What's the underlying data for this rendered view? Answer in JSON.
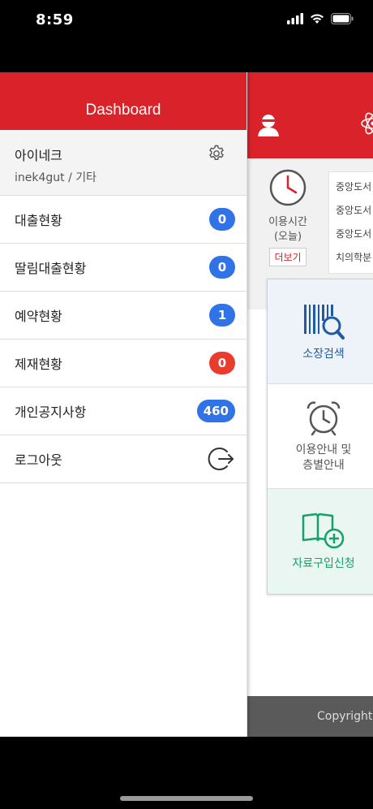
{
  "status": {
    "time": "8:59"
  },
  "drawer": {
    "title": "Dashboard",
    "profile": {
      "name": "아이네크",
      "subtitle": "inek4gut / 기타"
    },
    "items": [
      {
        "label": "대출현황",
        "badge": "0",
        "badge_color": "#2f73e6"
      },
      {
        "label": "딸림대출현황",
        "badge": "0",
        "badge_color": "#2f73e6"
      },
      {
        "label": "예약현황",
        "badge": "1",
        "badge_color": "#2f73e6"
      },
      {
        "label": "제재현황",
        "badge": "0",
        "badge_color": "#ea3b2f"
      },
      {
        "label": "개인공지사항",
        "badge": "460",
        "badge_color": "#2f73e6"
      }
    ],
    "logout_label": "로그아웃"
  },
  "background": {
    "usage_time_label": "이용시간\n(오늘)",
    "usage_time_line1": "이용시간",
    "usage_time_line2": "(오늘)",
    "more_label": "더보기",
    "libraries": [
      "중앙도서",
      "중앙도서",
      "중앙도서",
      "치의학분"
    ],
    "menu": {
      "search_label": "소장검색",
      "guide_line1": "이용안내 및",
      "guide_line2": "층별안내",
      "request_label": "자료구입신청"
    },
    "footer": "Copyright"
  },
  "colors": {
    "brand_red": "#d9222a",
    "badge_blue": "#2f73e6",
    "badge_red": "#ea3b2f"
  }
}
